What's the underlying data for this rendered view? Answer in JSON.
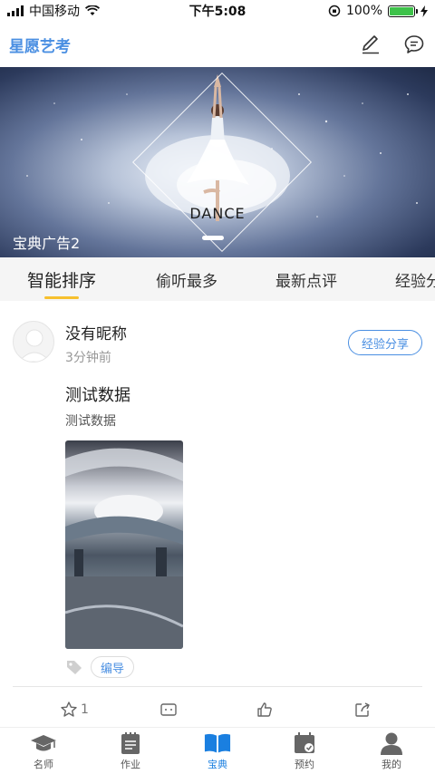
{
  "status_bar": {
    "carrier": "中国移动",
    "time": "下午5:08",
    "battery": "100%"
  },
  "header": {
    "title": "星愿艺考",
    "icons": [
      "pencil-icon",
      "chat-bubble-icon"
    ]
  },
  "banner": {
    "caption": "DANCE",
    "label": "宝典广告2",
    "active_slide": 2
  },
  "tabs": [
    {
      "label": "智能排序",
      "active": true
    },
    {
      "label": "偷听最多",
      "active": false
    },
    {
      "label": "最新点评",
      "active": false
    },
    {
      "label": "经验分",
      "active": false
    }
  ],
  "post": {
    "author": "没有昵称",
    "time": "3分钟前",
    "category": "经验分享",
    "title": "测试数据",
    "body": "测试数据",
    "tag": "编导",
    "actions": {
      "star_count": "1"
    }
  },
  "tabbar": [
    {
      "label": "名师",
      "icon": "graduation-cap-icon",
      "active": false
    },
    {
      "label": "作业",
      "icon": "notepad-icon",
      "active": false
    },
    {
      "label": "宝典",
      "icon": "open-book-icon",
      "active": true
    },
    {
      "label": "预约",
      "icon": "calendar-check-icon",
      "active": false
    },
    {
      "label": "我的",
      "icon": "person-icon",
      "active": false
    }
  ],
  "colors": {
    "accent": "#4a8fe2",
    "tab_indicator": "#f7c02e",
    "tabbar_active": "#1a7fe0"
  }
}
